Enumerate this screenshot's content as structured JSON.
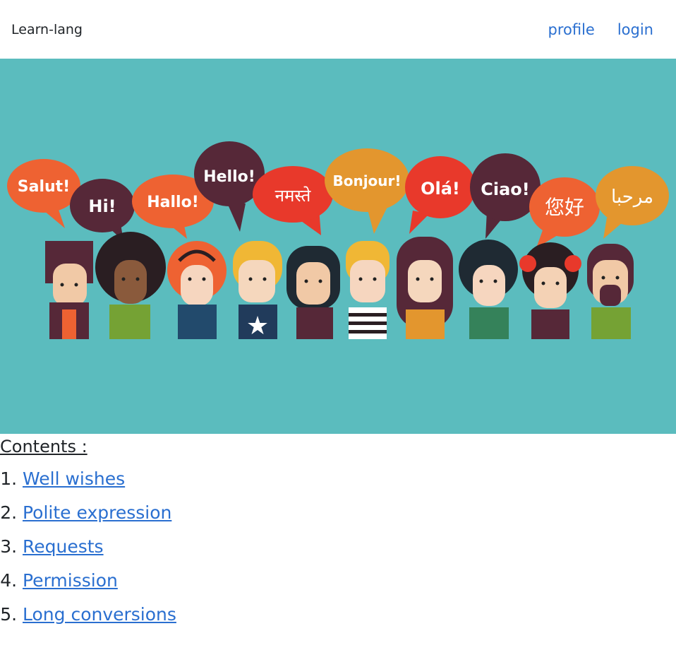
{
  "navbar": {
    "brand": "Learn-lang",
    "links": [
      {
        "label": "profile"
      },
      {
        "label": "login"
      }
    ]
  },
  "hero": {
    "background_color": "#5bbcbe",
    "bubbles": [
      {
        "text": "Salut!",
        "color": "#ee6232"
      },
      {
        "text": "Hi!",
        "color": "#562838"
      },
      {
        "text": "Hallo!",
        "color": "#ee6232"
      },
      {
        "text": "Hello!",
        "color": "#562838"
      },
      {
        "text": "नमस्ते",
        "color": "#e8392b"
      },
      {
        "text": "Bonjour!",
        "color": "#e3962e"
      },
      {
        "text": "Olá!",
        "color": "#e8392b"
      },
      {
        "text": "Ciao!",
        "color": "#562838"
      },
      {
        "text": "您好",
        "color": "#ee6232"
      },
      {
        "text": "مرحبا",
        "color": "#e3962e"
      }
    ]
  },
  "contents": {
    "title": "Contents :",
    "items": [
      {
        "label": "Well wishes"
      },
      {
        "label": "Polite expression"
      },
      {
        "label": "Requests"
      },
      {
        "label": "Permission"
      },
      {
        "label": "Long conversions"
      }
    ]
  }
}
